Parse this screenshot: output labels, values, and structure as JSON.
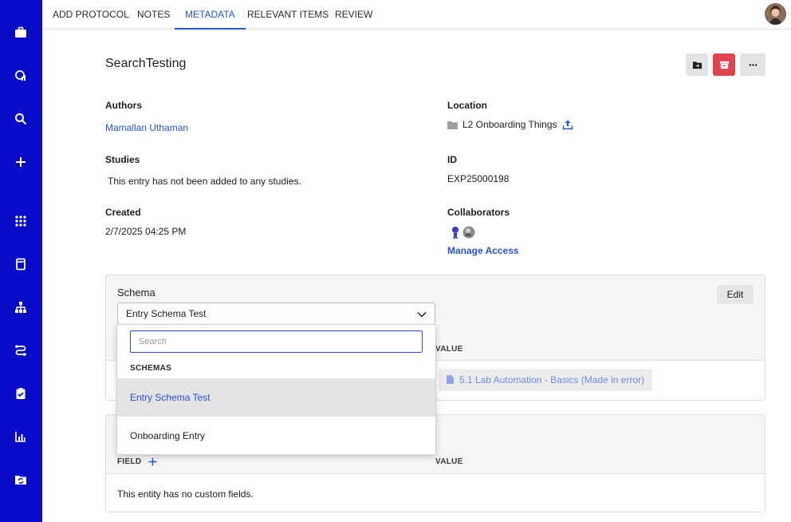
{
  "sidebar": {
    "items": [
      {
        "name": "briefcase-icon"
      },
      {
        "name": "insights-icon"
      },
      {
        "name": "search-icon"
      },
      {
        "name": "plus-icon"
      },
      {
        "name": "apps-grid-icon"
      },
      {
        "name": "notebook-icon"
      },
      {
        "name": "hierarchy-icon"
      },
      {
        "name": "workflow-icon"
      },
      {
        "name": "clipboard-check-icon"
      },
      {
        "name": "bar-chart-icon"
      },
      {
        "name": "folder-sync-icon"
      }
    ]
  },
  "tabs": [
    {
      "label": "ADD PROTOCOL"
    },
    {
      "label": "NOTES"
    },
    {
      "label": "METADATA",
      "active": true
    },
    {
      "label": "RELEVANT ITEMS"
    },
    {
      "label": "REVIEW"
    }
  ],
  "entry": {
    "title": "SearchTesting"
  },
  "actions": {
    "move_icon": "folder-move-icon",
    "archive_icon": "archive-icon",
    "more_icon": "more-horizontal-icon",
    "archive_color": "#e0434d"
  },
  "meta": {
    "authors_label": "Authors",
    "author_name": "Mamallan Uthaman",
    "location_label": "Location",
    "location_value": "L2 Onboarding Things",
    "studies_label": "Studies",
    "studies_value": "This entry has not been added to any studies.",
    "id_label": "ID",
    "id_value": "EXP25000198",
    "created_label": "Created",
    "created_value": "2/7/2025 04:25 PM",
    "collaborators_label": "Collaborators",
    "manage_access": "Manage Access"
  },
  "schema": {
    "label": "Schema",
    "selected": "Entry Schema Test",
    "edit_label": "Edit",
    "value_header": "VALUE",
    "chip_text": "5.1 Lab Automation - Basics (Made in error)"
  },
  "dropdown": {
    "search_placeholder": "Search",
    "section_header": "SCHEMAS",
    "options": [
      {
        "label": "Entry Schema Test",
        "selected": true
      },
      {
        "label": "Onboarding Entry"
      }
    ]
  },
  "custom_fields": {
    "field_header": "FIELD",
    "value_header": "VALUE",
    "empty_text": "This entity has no custom fields."
  },
  "colors": {
    "sidebar": "#0b0bc7",
    "accent": "#2a52d8",
    "danger": "#e0434d"
  }
}
